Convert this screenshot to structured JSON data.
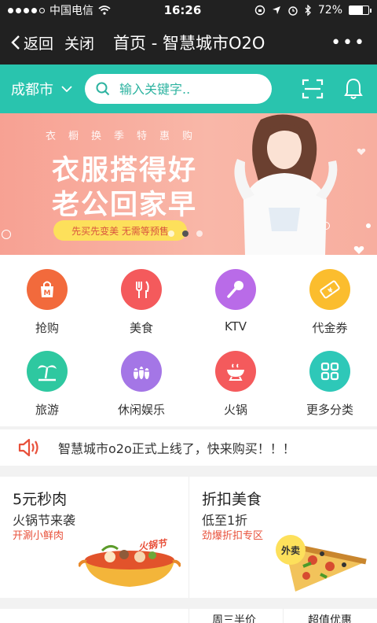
{
  "status_bar": {
    "carrier": "中国电信",
    "time": "16:26",
    "battery": "72%",
    "battery_level": 0.72
  },
  "nav": {
    "back_label": "返回",
    "close_label": "关闭",
    "title": "首页 - 智慧城市O2O",
    "more_label": "•••"
  },
  "search": {
    "city": "成都市",
    "placeholder": "输入关键字.."
  },
  "banner": {
    "subtitle": "衣橱换季特惠购",
    "headline_1": "衣服搭得好",
    "headline_2": "老公回家早",
    "tagline": "先买先变美  无需等预售"
  },
  "categories": [
    {
      "label": "抢购",
      "icon": "shopping-bag-icon",
      "color": "#f26a3c"
    },
    {
      "label": "美食",
      "icon": "fork-knife-icon",
      "color": "#f45a5c"
    },
    {
      "label": "KTV",
      "icon": "microphone-icon",
      "color": "#b96be8"
    },
    {
      "label": "代金券",
      "icon": "coupon-icon",
      "color": "#fbbd2e"
    },
    {
      "label": "旅游",
      "icon": "palm-tree-icon",
      "color": "#2ec8a0"
    },
    {
      "label": "休闲娱乐",
      "icon": "bowling-icon",
      "color": "#a476e6"
    },
    {
      "label": "火锅",
      "icon": "hotpot-icon",
      "color": "#f45a5c"
    },
    {
      "label": "更多分类",
      "icon": "grid-icon",
      "color": "#2ec8b8"
    }
  ],
  "announcement": {
    "text": "智慧城市o2o正式上线了，快来购买！！！"
  },
  "promos": [
    {
      "title": "5元秒肉",
      "subtitle": "火锅节来袭",
      "tag": "开涮小鲜肉",
      "art_label": "火锅节",
      "icon": "hotpot-dish-icon"
    },
    {
      "title": "折扣美食",
      "subtitle": "低至1折",
      "tag": "劲爆折扣专区",
      "art_label": "外卖",
      "icon": "pizza-icon"
    }
  ],
  "bottom_row": {
    "item_1": "周三半价",
    "item_2": "超值优惠"
  },
  "colors": {
    "topbar": "#212121",
    "accent": "#29c4ae",
    "banner": "#f7a193",
    "highlight": "#e8503a"
  }
}
